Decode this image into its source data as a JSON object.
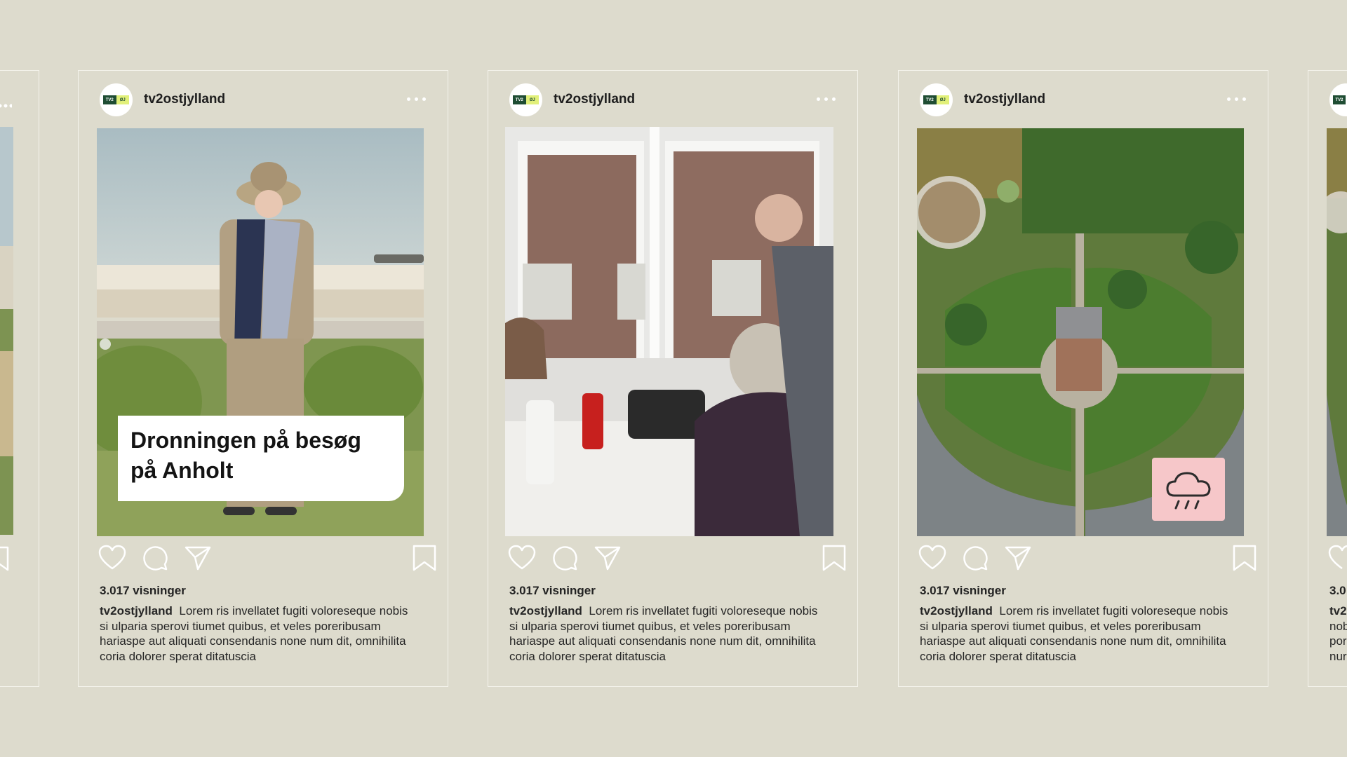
{
  "posts": [
    {
      "username": "tv2ostjylland",
      "logo": {
        "left": "TV2",
        "right": "ØJ"
      },
      "overlay_title": "Dronningen på besøg på Anholt",
      "views": "3.017 visninger",
      "caption_user": "tv2ostjylland",
      "caption_text": "Lorem ris invellatet fugiti voloreseque nobis si ulparia sperovi tiumet quibus, et veles poreribusam hariaspe aut aliquati consendanis none num dit, omnihilita coria dolorer sperat ditatuscia"
    },
    {
      "username": "tv2ostjylland",
      "logo": {
        "left": "TV2",
        "right": "ØJ"
      },
      "views": "3.017 visninger",
      "caption_user": "tv2ostjylland",
      "caption_text": "Lorem ris invellatet fugiti voloreseque nobis si ulparia sperovi tiumet quibus, et veles poreribusam hariaspe aut aliquati consendanis none num dit, omnihilita coria dolorer sperat ditatuscia"
    },
    {
      "username": "tv2ostjylland",
      "logo": {
        "left": "TV2",
        "right": "ØJ"
      },
      "views": "3.017 visninger",
      "caption_user": "tv2ostjylland",
      "caption_text": "Lorem ris invellatet fugiti voloreseque nobis si ulparia sperovi tiumet quibus, et veles poreribusam hariaspe aut aliquati consendanis none num dit, omnihilita coria dolorer sperat ditatuscia",
      "badge_icon": "rain-cloud-icon"
    }
  ],
  "edge_posts": {
    "right": {
      "logo": "TV2",
      "views_partial": "3.0",
      "caption_partial": [
        "tv2",
        "nob",
        "por",
        "nur"
      ]
    }
  },
  "colors": {
    "background": "#dddbcd",
    "card_border": "#f4f3ec",
    "logo_green": "#1f4d33",
    "logo_lime": "#e2f07a",
    "badge_pink": "#f6c7c9"
  },
  "icons": [
    "heart-icon",
    "comment-icon",
    "share-icon",
    "bookmark-icon",
    "more-icon"
  ]
}
